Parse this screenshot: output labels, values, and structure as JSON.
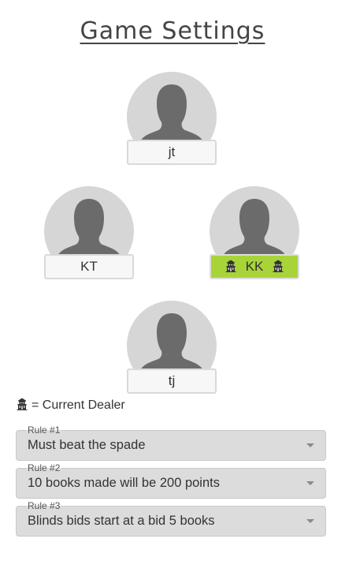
{
  "title": "Game Settings",
  "players": {
    "top": {
      "name": "jt",
      "is_dealer": false
    },
    "left": {
      "name": "KT",
      "is_dealer": false
    },
    "right": {
      "name": "KK",
      "is_dealer": true
    },
    "bottom": {
      "name": "tj",
      "is_dealer": false
    }
  },
  "legend": {
    "text": "= Current Dealer",
    "icon": "dealer-icon"
  },
  "rules": [
    {
      "label": "Rule #1",
      "value": "Must beat the spade"
    },
    {
      "label": "Rule #2",
      "value": "10 books made will be 200 points"
    },
    {
      "label": "Rule #3",
      "value": "Blinds bids start at a bid 5 books"
    }
  ],
  "colors": {
    "dealer_highlight": "#a8d43a",
    "avatar_bg": "#d6d6d6",
    "avatar_silhouette": "#6b6b6b",
    "select_bg": "#dcdcdc"
  }
}
